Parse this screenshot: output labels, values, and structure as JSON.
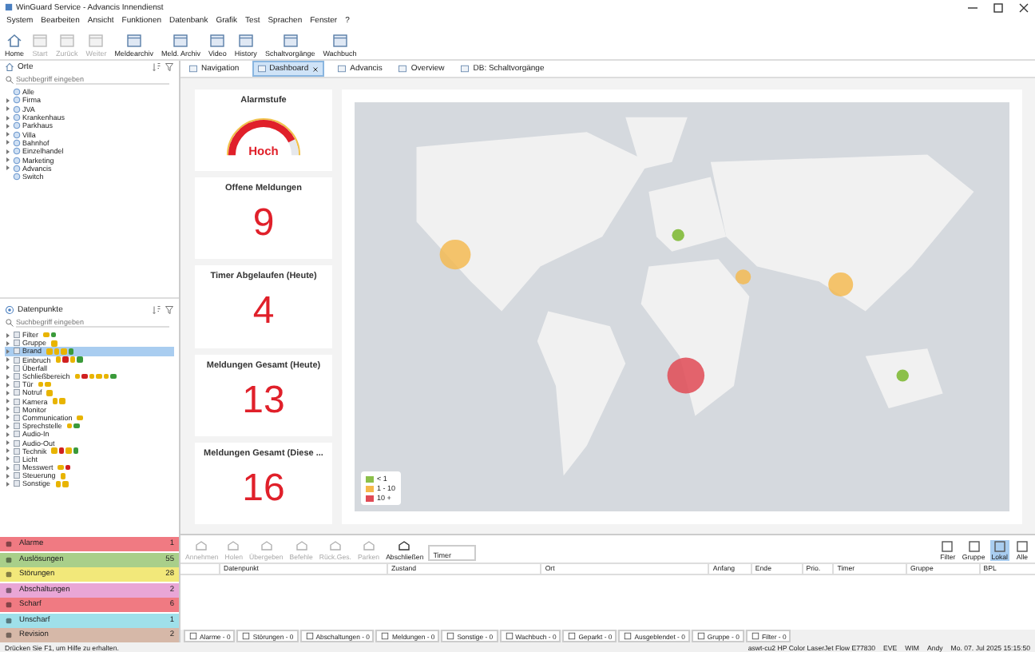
{
  "window": {
    "title": "WinGuard Service - Advancis Innendienst"
  },
  "menu": [
    "System",
    "Bearbeiten",
    "Ansicht",
    "Funktionen",
    "Datenbank",
    "Grafik",
    "Test",
    "Sprachen",
    "Fenster",
    "?"
  ],
  "toolbar": [
    {
      "label": "Home",
      "disabled": false
    },
    {
      "label": "Start",
      "disabled": true
    },
    {
      "label": "Zurück",
      "disabled": true
    },
    {
      "label": "Weiter",
      "disabled": true
    },
    {
      "label": "Meldearchiv",
      "disabled": false
    },
    {
      "label": "Meld. Archiv",
      "disabled": false
    },
    {
      "label": "Video",
      "disabled": false
    },
    {
      "label": "History",
      "disabled": false
    },
    {
      "label": "Schaltvorgänge",
      "disabled": false
    },
    {
      "label": "Wachbuch",
      "disabled": false
    }
  ],
  "locations": {
    "title": "Orte",
    "placeholder": "Suchbegriff eingeben",
    "items": [
      {
        "label": "Alle",
        "has_children": false
      },
      {
        "label": "Firma",
        "has_children": true
      },
      {
        "label": "JVA",
        "has_children": true
      },
      {
        "label": "Krankenhaus",
        "has_children": true
      },
      {
        "label": "Parkhaus",
        "has_children": true
      },
      {
        "label": "Villa",
        "has_children": true
      },
      {
        "label": "Bahnhof",
        "has_children": true
      },
      {
        "label": "Einzelhandel",
        "has_children": true
      },
      {
        "label": "Marketing",
        "has_children": true
      },
      {
        "label": "Advancis",
        "has_children": true
      },
      {
        "label": "Switch",
        "has_children": false
      }
    ]
  },
  "datapoints": {
    "title": "Datenpunkte",
    "placeholder": "Suchbegriff eingeben",
    "items": [
      {
        "label": "Filter",
        "selected": false,
        "badges": [
          {
            "color": "#e8b400"
          },
          {
            "color": "#3a9a3a"
          }
        ]
      },
      {
        "label": "Gruppe",
        "selected": false,
        "badges": [
          {
            "color": "#e8b400"
          }
        ]
      },
      {
        "label": "Brand",
        "selected": true,
        "badges": [
          {
            "color": "#e8b400"
          },
          {
            "color": "#e8b400"
          },
          {
            "color": "#e8b400"
          },
          {
            "color": "#3a9a3a"
          }
        ]
      },
      {
        "label": "Einbruch",
        "selected": false,
        "badges": [
          {
            "color": "#e8b400"
          },
          {
            "color": "#d02020"
          },
          {
            "color": "#e8b400"
          },
          {
            "color": "#3a9a3a"
          }
        ]
      },
      {
        "label": "Überfall",
        "selected": false
      },
      {
        "label": "Schließbereich",
        "selected": false,
        "badges": [
          {
            "color": "#e8b400"
          },
          {
            "color": "#d02020"
          },
          {
            "color": "#e8b400"
          },
          {
            "color": "#e8b400"
          },
          {
            "color": "#e8b400"
          },
          {
            "color": "#3a9a3a"
          }
        ]
      },
      {
        "label": "Tür",
        "selected": false,
        "badges": [
          {
            "color": "#e8b400"
          },
          {
            "color": "#e8b400"
          }
        ]
      },
      {
        "label": "Notruf",
        "selected": false,
        "badges": [
          {
            "color": "#e8b400"
          }
        ]
      },
      {
        "label": "Kamera",
        "selected": false,
        "badges": [
          {
            "color": "#e8b400"
          },
          {
            "color": "#e8b400"
          }
        ]
      },
      {
        "label": "Monitor",
        "selected": false
      },
      {
        "label": "Communication",
        "selected": false,
        "badges": [
          {
            "color": "#e8b400"
          }
        ]
      },
      {
        "label": "Sprechstelle",
        "selected": false,
        "badges": [
          {
            "color": "#e8b400"
          },
          {
            "color": "#3a9a3a"
          }
        ]
      },
      {
        "label": "Audio-In",
        "selected": false
      },
      {
        "label": "Audio-Out",
        "selected": false
      },
      {
        "label": "Technik",
        "selected": false,
        "badges": [
          {
            "color": "#e8b400"
          },
          {
            "color": "#d02020"
          },
          {
            "color": "#e8b400"
          },
          {
            "color": "#3a9a3a"
          }
        ]
      },
      {
        "label": "Licht",
        "selected": false
      },
      {
        "label": "Messwert",
        "selected": false,
        "badges": [
          {
            "color": "#e8b400"
          },
          {
            "color": "#d02020"
          }
        ]
      },
      {
        "label": "Steuerung",
        "selected": false,
        "badges": [
          {
            "color": "#e8b400"
          }
        ]
      },
      {
        "label": "Sonstige",
        "selected": false,
        "badges": [
          {
            "color": "#e8b400"
          },
          {
            "color": "#e8b400"
          }
        ]
      }
    ]
  },
  "categories": [
    {
      "label": "Alarme",
      "count": "1",
      "color": "#f07a82"
    },
    {
      "label": "Auslösungen",
      "count": "55",
      "color": "#a9cf8a"
    },
    {
      "label": "Störungen",
      "count": "28",
      "color": "#f2e87a"
    },
    {
      "label": "Abschaltungen",
      "count": "2",
      "color": "#e9a6d6"
    },
    {
      "label": "Scharf",
      "count": "6",
      "color": "#f07a82"
    },
    {
      "label": "Unscharf",
      "count": "1",
      "color": "#9fe0ea"
    },
    {
      "label": "Revision",
      "count": "2",
      "color": "#d6b8a8"
    }
  ],
  "tabs": [
    {
      "label": "Navigation",
      "selected": false,
      "closable": false
    },
    {
      "label": "Dashboard",
      "selected": true,
      "closable": true
    },
    {
      "label": "Advancis",
      "selected": false,
      "closable": false
    },
    {
      "label": "Overview",
      "selected": false,
      "closable": false
    },
    {
      "label": "DB: Schaltvorgänge",
      "selected": false,
      "closable": false
    }
  ],
  "alarm": {
    "title": "Alarmstufe",
    "value": "Hoch",
    "level": 0.85
  },
  "cards": [
    {
      "title": "Offene Meldungen",
      "value": "9"
    },
    {
      "title": "Timer Abgelaufen (Heute)",
      "value": "4"
    },
    {
      "title": "Meldungen Gesamt (Heute)",
      "value": "13"
    },
    {
      "title": "Meldungen Gesamt (Diese ...",
      "value": "16"
    }
  ],
  "legend": [
    {
      "label": "< 1",
      "color": "#8cc04a"
    },
    {
      "label": "1 - 10",
      "color": "#f5b84a"
    },
    {
      "label": "10 +",
      "color": "#e04a55"
    }
  ],
  "actions": [
    {
      "label": "Annehmen",
      "disabled": true
    },
    {
      "label": "Holen",
      "disabled": true
    },
    {
      "label": "Übergeben",
      "disabled": true
    },
    {
      "label": "Befehle",
      "disabled": true
    },
    {
      "label": "Rück.Ges.",
      "disabled": true
    },
    {
      "label": "Parken",
      "disabled": true
    },
    {
      "label": "Abschließen",
      "disabled": false
    }
  ],
  "timer_label": "Timer",
  "views": [
    {
      "label": "Filter",
      "selected": false
    },
    {
      "label": "Gruppe",
      "selected": false
    },
    {
      "label": "Lokal",
      "selected": true
    },
    {
      "label": "Alle",
      "selected": false
    }
  ],
  "table": {
    "columns": [
      "Datenpunkt",
      "Zustand",
      "Ort",
      "Anfang",
      "Ende",
      "Prio.",
      "Timer",
      "Gruppe",
      "BPL"
    ]
  },
  "bottom_tabs": [
    "Alarme - 0",
    "Störungen - 0",
    "Abschaltungen - 0",
    "Meldungen - 0",
    "Sonstige - 0",
    "Wachbuch - 0",
    "Geparkt - 0",
    "Ausgeblendet - 0",
    "Gruppe - 0",
    "Filter - 0"
  ],
  "status_bar": {
    "help": "Drücken Sie F1, um Hilfe zu erhalten.",
    "right": [
      "aswt-cu2 HP Color LaserJet Flow E77830",
      "EVE",
      "WIM",
      "Andy",
      "Mo. 07. Jul 2025 15:15:50"
    ]
  }
}
